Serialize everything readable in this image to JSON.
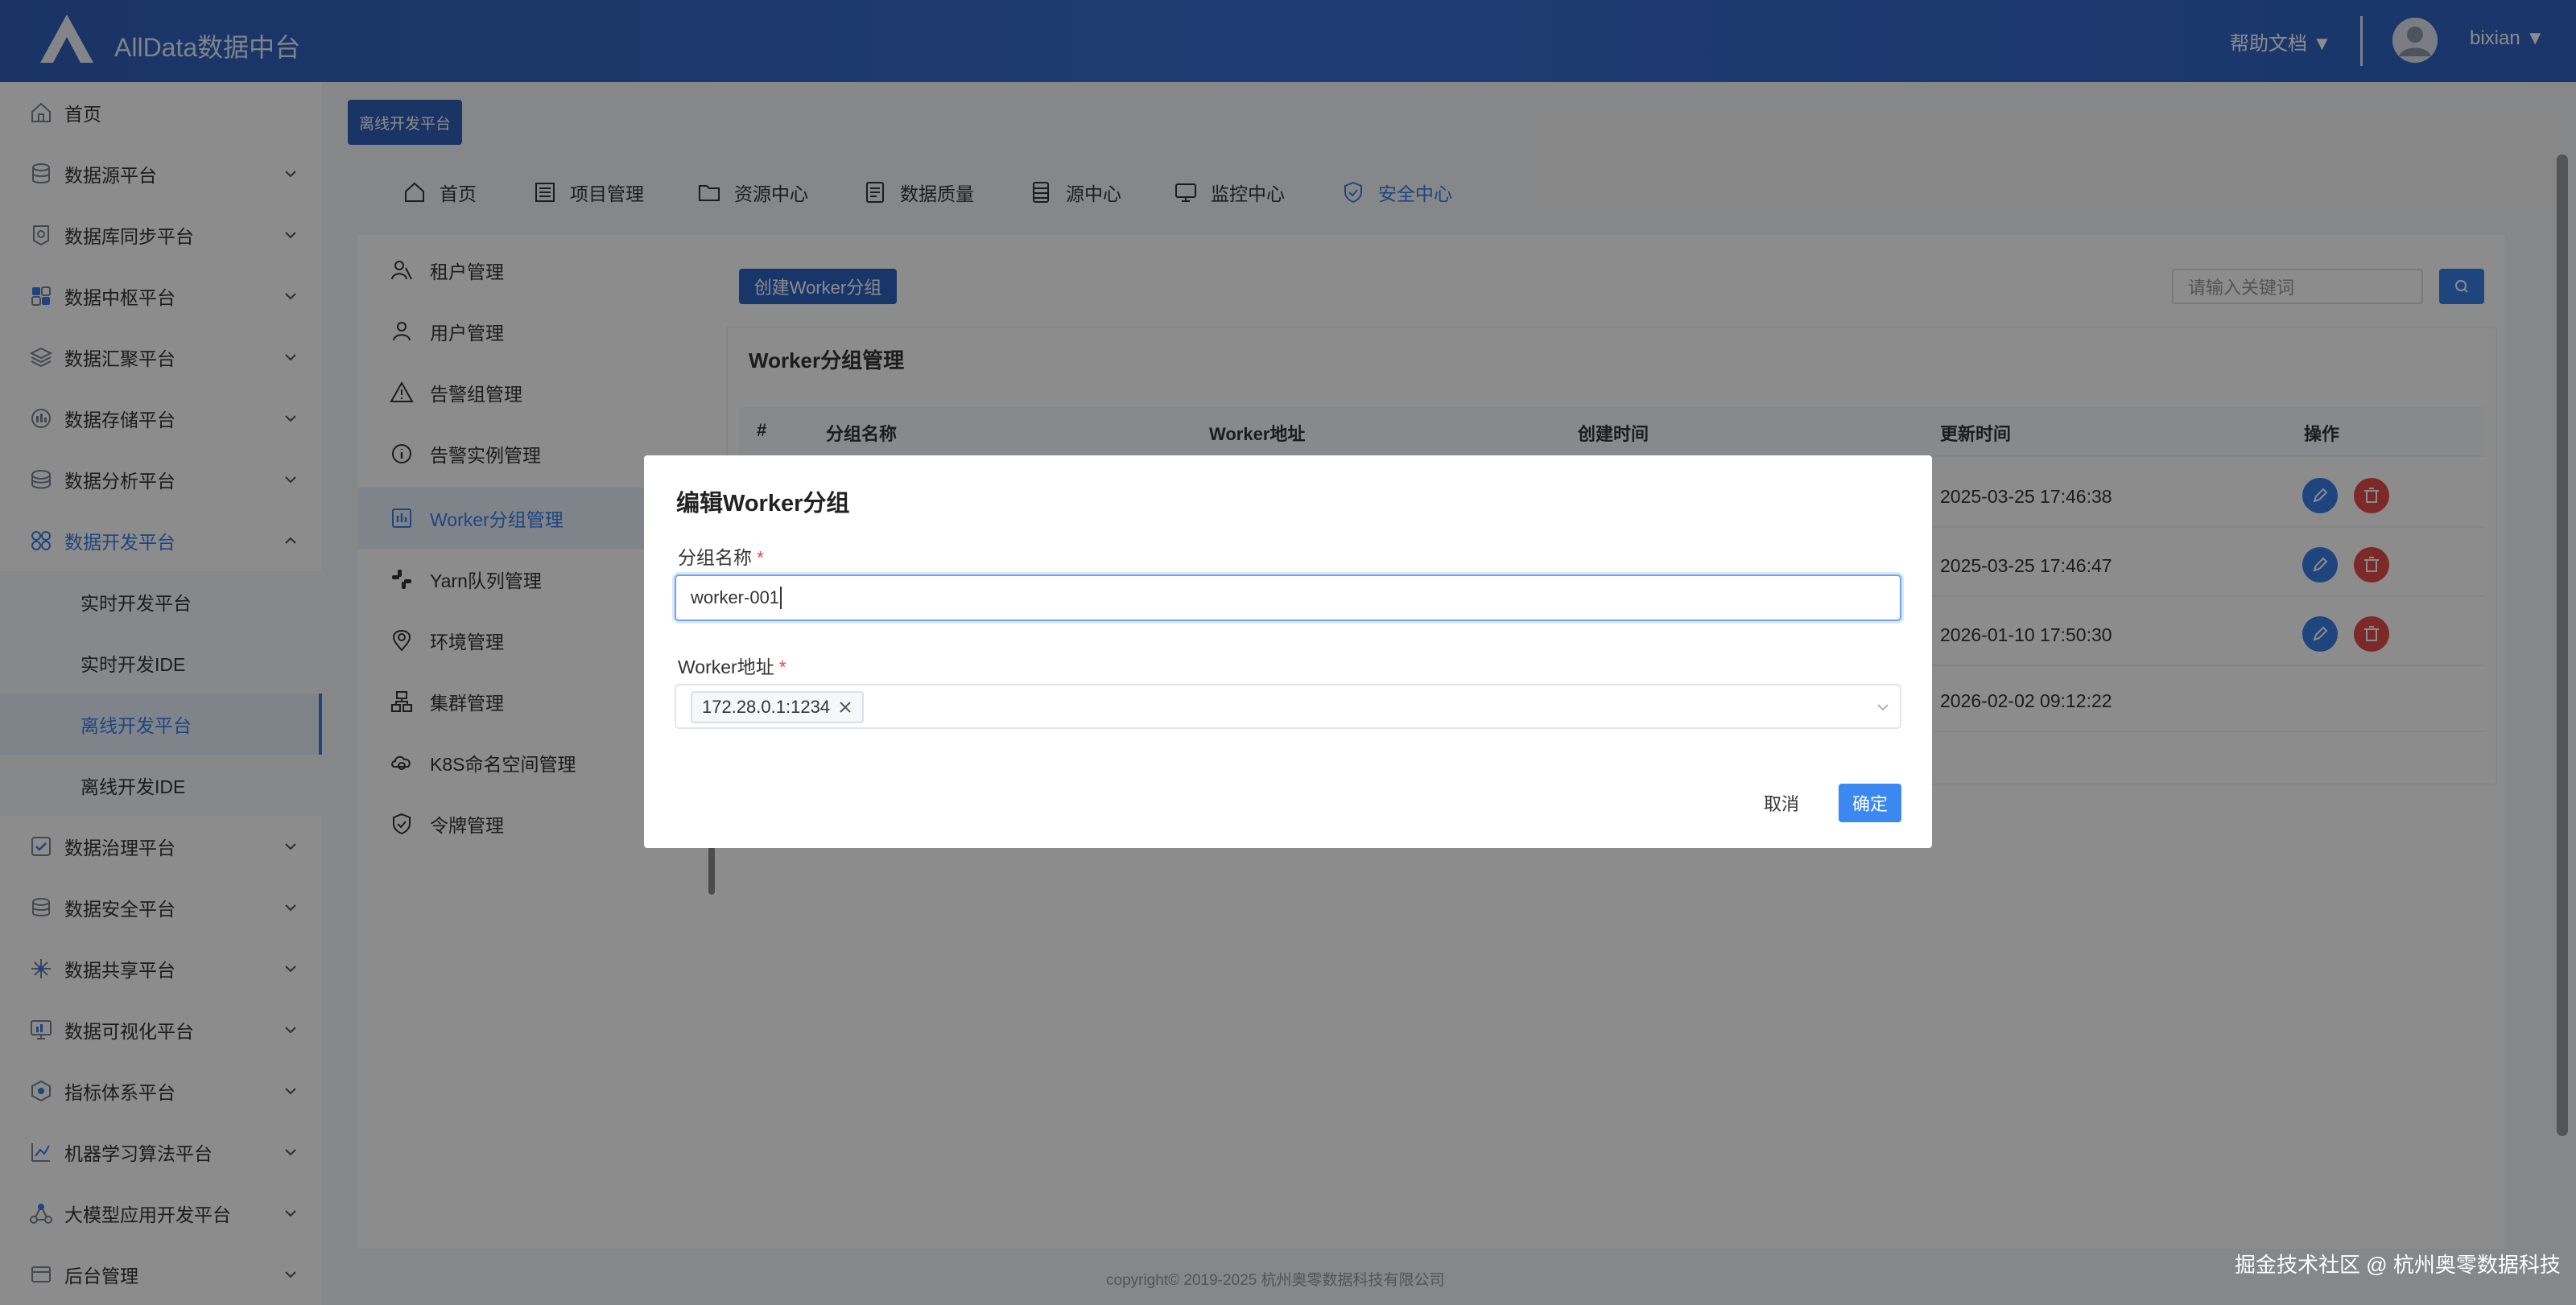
{
  "header": {
    "brand": "AllData数据中台",
    "help": "帮助文档 ▼",
    "user": "bixian ▼"
  },
  "sidebar": {
    "items": [
      {
        "label": "首页",
        "icon": "home-icon"
      },
      {
        "label": "数据源平台",
        "icon": "database-icon"
      },
      {
        "label": "数据库同步平台",
        "icon": "sync-icon"
      },
      {
        "label": "数据中枢平台",
        "icon": "grid-icon"
      },
      {
        "label": "数据汇聚平台",
        "icon": "layers-icon"
      },
      {
        "label": "数据存储平台",
        "icon": "storage-icon"
      },
      {
        "label": "数据分析平台",
        "icon": "analytics-icon"
      },
      {
        "label": "数据开发平台",
        "icon": "dev-icon"
      },
      {
        "label": "实时开发平台"
      },
      {
        "label": "实时开发IDE"
      },
      {
        "label": "离线开发平台"
      },
      {
        "label": "离线开发IDE"
      },
      {
        "label": "数据治理平台",
        "icon": "governance-icon"
      },
      {
        "label": "数据安全平台",
        "icon": "security-icon"
      },
      {
        "label": "数据共享平台",
        "icon": "share-icon"
      },
      {
        "label": "数据可视化平台",
        "icon": "chart-icon"
      },
      {
        "label": "指标体系平台",
        "icon": "metrics-icon"
      },
      {
        "label": "机器学习算法平台",
        "icon": "ml-icon"
      },
      {
        "label": "大模型应用开发平台",
        "icon": "llm-icon"
      },
      {
        "label": "后台管理",
        "icon": "admin-icon"
      }
    ]
  },
  "breadcrumb": {
    "current": "离线开发平台"
  },
  "topnav": {
    "tabs": [
      {
        "label": "首页",
        "icon": "home-icon"
      },
      {
        "label": "项目管理",
        "icon": "list-icon"
      },
      {
        "label": "资源中心",
        "icon": "folder-icon"
      },
      {
        "label": "数据质量",
        "icon": "doc-icon"
      },
      {
        "label": "源中心",
        "icon": "table-icon"
      },
      {
        "label": "监控中心",
        "icon": "monitor-icon"
      },
      {
        "label": "安全中心",
        "icon": "shield-icon",
        "active": true
      }
    ]
  },
  "submenu": {
    "items": [
      {
        "label": "租户管理",
        "icon": "tenant-icon"
      },
      {
        "label": "用户管理",
        "icon": "user-icon"
      },
      {
        "label": "告警组管理",
        "icon": "warning-icon"
      },
      {
        "label": "告警实例管理",
        "icon": "info-icon"
      },
      {
        "label": "Worker分组管理",
        "icon": "worker-icon",
        "selected": true
      },
      {
        "label": "Yarn队列管理",
        "icon": "queue-icon"
      },
      {
        "label": "环境管理",
        "icon": "location-icon"
      },
      {
        "label": "集群管理",
        "icon": "cluster-icon"
      },
      {
        "label": "K8S命名空间管理",
        "icon": "k8s-icon"
      },
      {
        "label": "令牌管理",
        "icon": "token-icon"
      }
    ]
  },
  "content": {
    "create_button": "创建Worker分组",
    "search_placeholder": "请输入关键词",
    "panel_title": "Worker分组管理",
    "columns": [
      "#",
      "分组名称",
      "Worker地址",
      "创建时间",
      "更新时间",
      "操作"
    ],
    "rows": [
      {
        "updated": "2025-03-25 17:46:38"
      },
      {
        "updated": "2025-03-25 17:46:47"
      },
      {
        "updated": "2026-01-10 17:50:30"
      },
      {
        "updated": "2026-02-02 09:12:22"
      }
    ]
  },
  "footer": "copyright© 2019-2025 杭州奥零数据科技有限公司",
  "watermark": "掘金技术社区 @ 杭州奥零数据科技",
  "modal": {
    "title": "编辑Worker分组",
    "name_label": "分组名称",
    "name_value": "worker-001",
    "addr_label": "Worker地址",
    "required_mark": "*",
    "tags": [
      "172.28.0.1:1234"
    ],
    "cancel": "取消",
    "ok": "确定"
  },
  "colors": {
    "header": "#2f5fb9",
    "accent": "#3a7ee8",
    "danger": "#e44c4c",
    "required": "#e04b4b"
  }
}
